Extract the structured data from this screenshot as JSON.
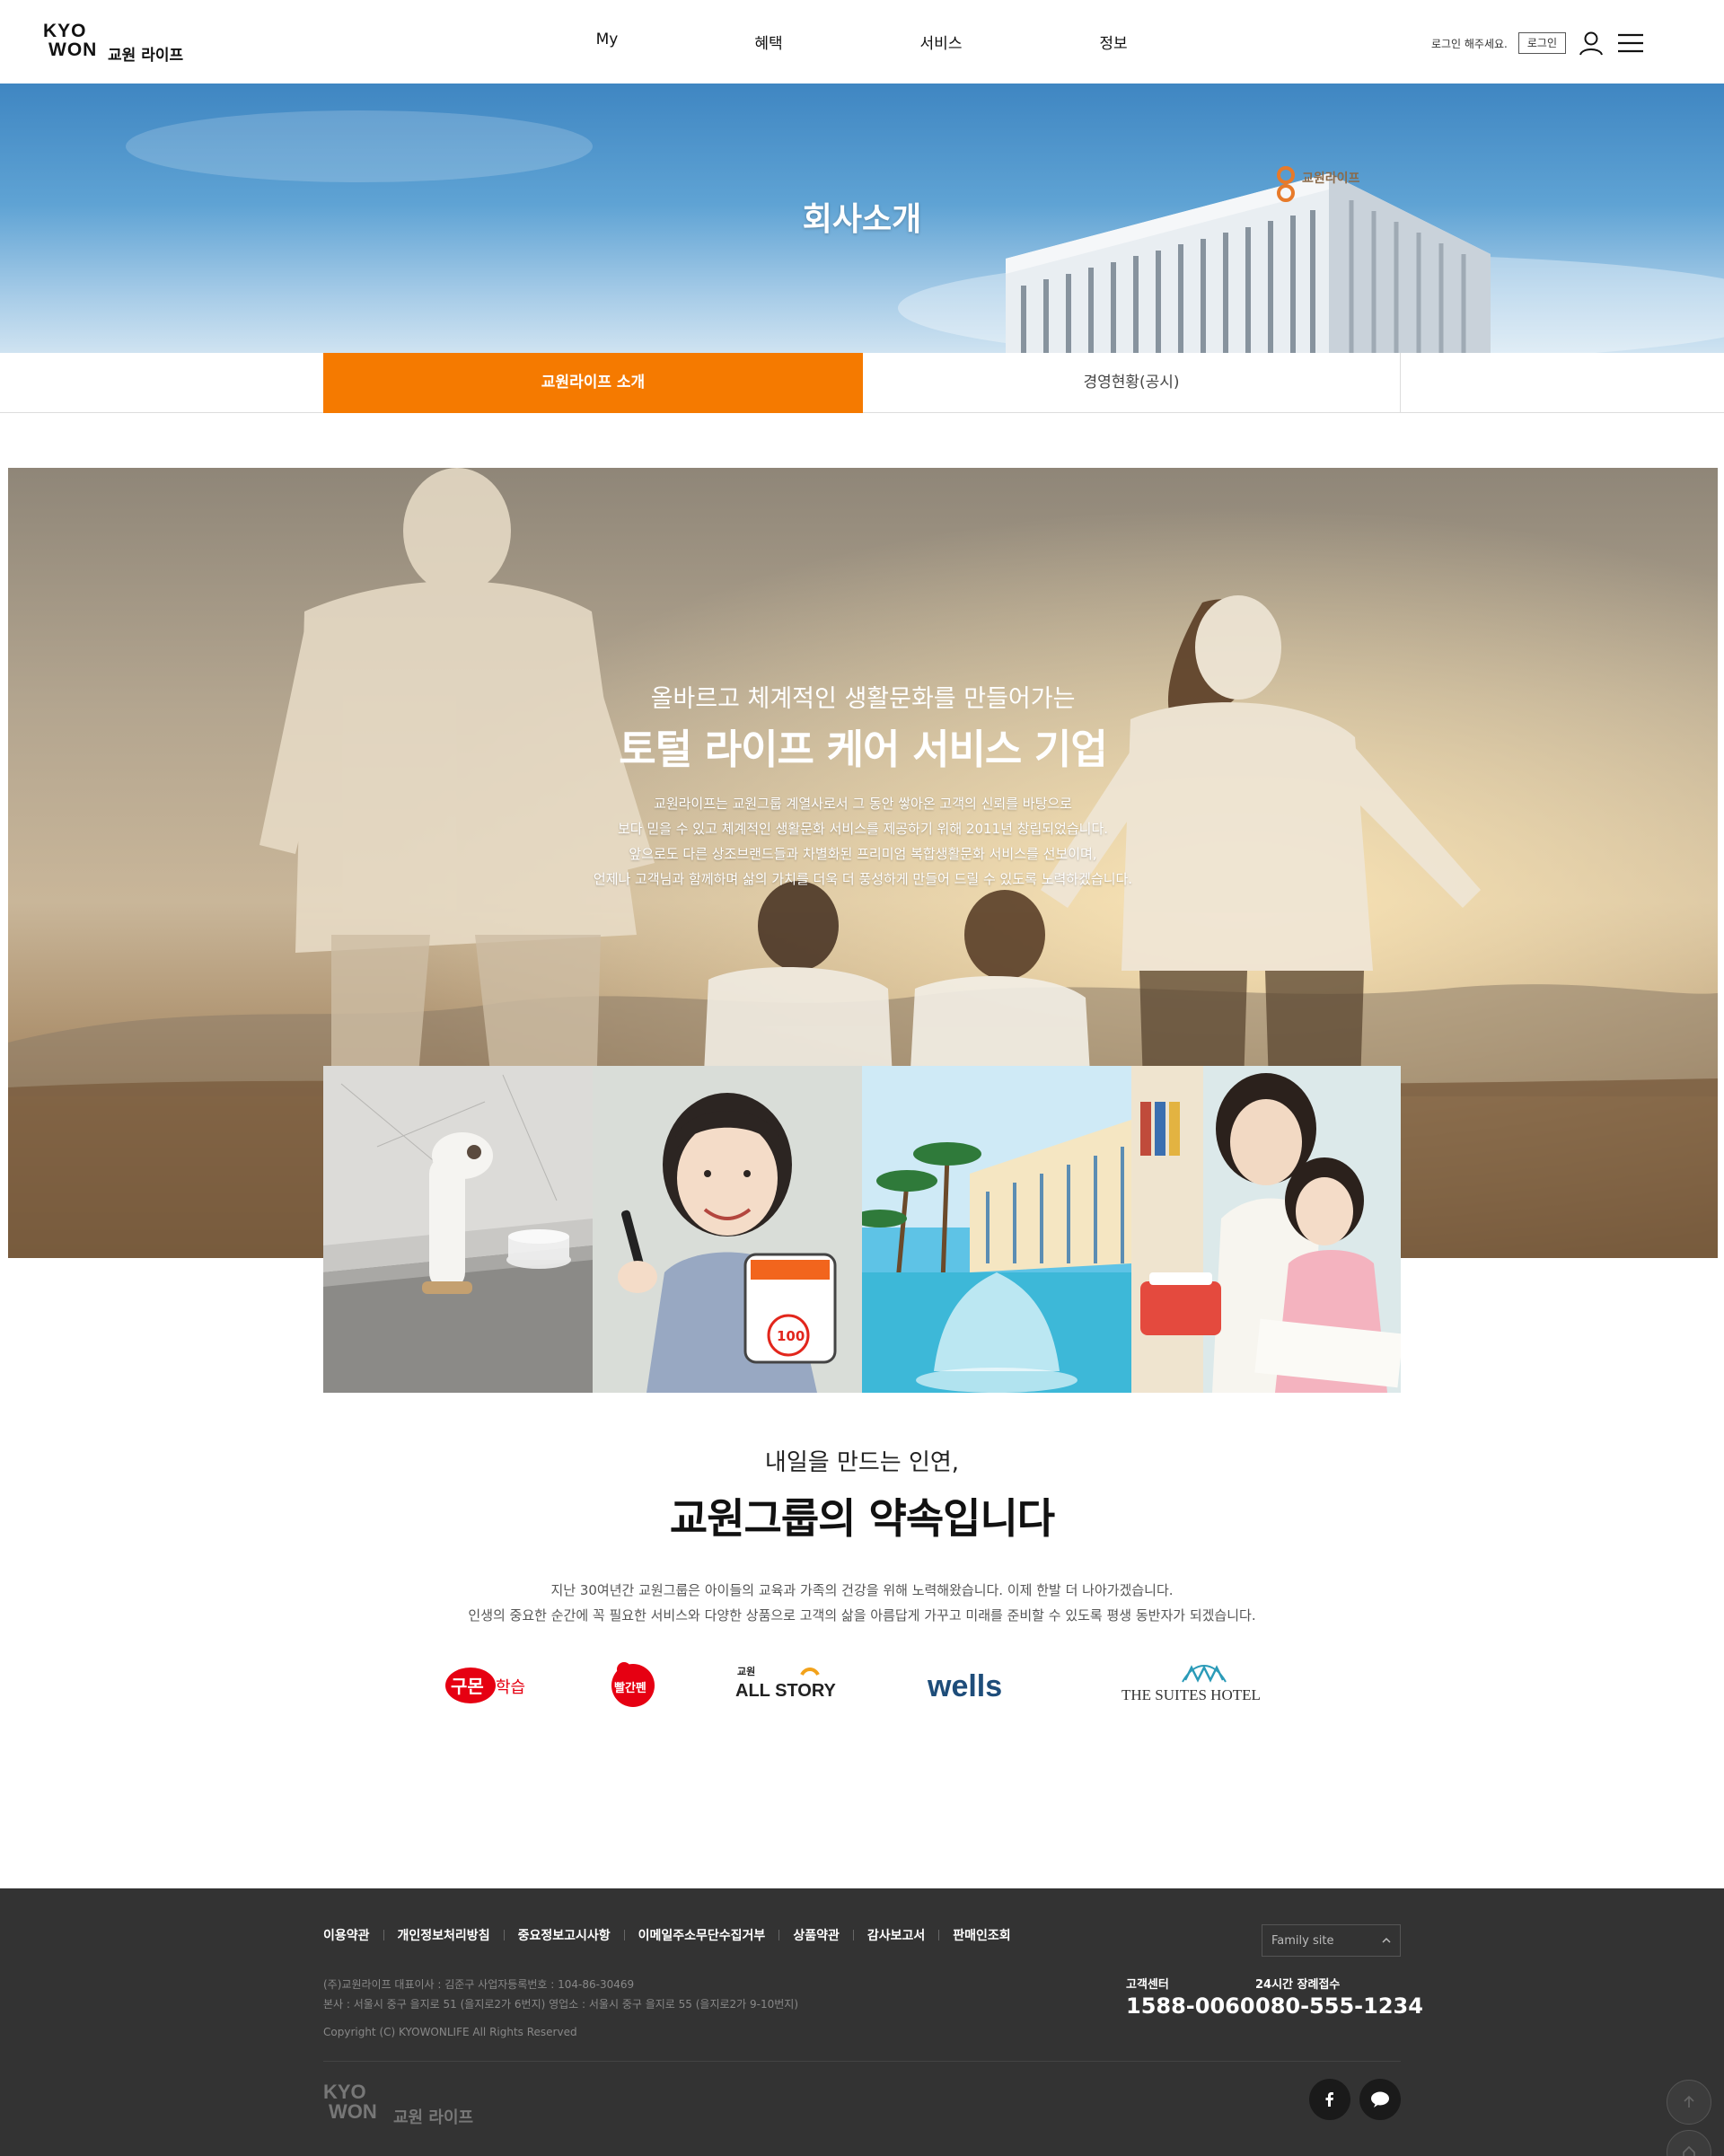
{
  "header": {
    "logo_mark_line1": "KYO",
    "logo_mark_line2": "WON",
    "logo_text": "교원 라이프",
    "nav": [
      "My",
      "혜택",
      "서비스",
      "정보"
    ],
    "login_message": "로그인 해주세요.",
    "login_button": "로그인",
    "icons": [
      "user-icon",
      "hamburger-menu-icon"
    ]
  },
  "hero": {
    "title": "회사소개",
    "building_sign": "교원라이프"
  },
  "tabs": [
    {
      "label": "교원라이프 소개",
      "active": true
    },
    {
      "label": "경영현황(공시)",
      "active": false
    }
  ],
  "intro": {
    "subtitle": "올바르고 체계적인 생활문화를 만들어가는",
    "title": "토털 라이프 케어 서비스 기업",
    "body": [
      "교원라이프는 교원그룹 계열사로서 그 동안 쌓아온 고객의 신뢰를 바탕으로",
      "보다 믿을 수 있고 체계적인 생활문화 서비스를 제공하기 위해 2011년 창립되었습니다.",
      "앞으로도 다른 상조브랜드들과 차별화된 프리미엄 복합생활문화 서비스를 선보이며,",
      "언제나 고객님과 함께하며 삶의 가치를 더욱 더 풍성하게 만들어 드릴 수 있도록 노력하겠습니다."
    ]
  },
  "photos": [
    "water-purifier-photo",
    "student-tablet-photo",
    "resort-pool-photo",
    "mother-daughter-study-photo"
  ],
  "photo_texts": {
    "score": "100"
  },
  "promise": {
    "subtitle": "내일을 만드는 인연,",
    "title": "교원그룹의 약속입니다",
    "body": [
      "지난 30여년간 교원그룹은 아이들의 교육과 가족의 건강을 위해 노력해왔습니다. 이제 한발 더 나아가겠습니다.",
      "인생의 중요한 순간에 꼭 필요한 서비스와 다양한 상품으로 고객의 삶을 아름답게 가꾸고 미래를 준비할 수 있도록 평생 동반자가 되겠습니다."
    ]
  },
  "brands": {
    "kumon_main": "구몬",
    "kumon_sub": "학습",
    "ppalgan": "빨간펜",
    "allstory_top": "교원",
    "allstory_main": "ALL STORY",
    "wells": "wells",
    "suites": "THE SUITES HOTEL"
  },
  "footer": {
    "links": [
      "이용약관",
      "개인정보처리방침",
      "중요정보고시사항",
      "이메일주소무단수집거부",
      "상품약관",
      "감사보고서",
      "판매인조회"
    ],
    "family_site": "Family site",
    "info_line1": "(주)교원라이프 대표이사 : 김준구 사업자등록번호 : 104-86-30469",
    "info_line2": "본사 : 서울시 중구 을지로 51 (을지로2가 6번지) 영업소 : 서울시 중구 을지로 55 (을지로2가 9-10번지)",
    "copyright": "Copyright (C) KYOWONLIFE All Rights Reserved",
    "cs_label": "고객센터",
    "cs_number": "1588-0060",
    "funeral_label": "24시간 장례접수",
    "funeral_number": "080-555-1234",
    "logo_mark_line1": "KYO",
    "logo_mark_line2": "WON",
    "logo_text": "교원 라이프",
    "social": [
      "facebook-icon",
      "talk-bubble-icon"
    ]
  },
  "colors": {
    "accent": "#f57a00",
    "logo_orange": "#f47920",
    "footer_bg": "#333333",
    "wells_blue": "#1e4d7a",
    "kumon_red": "#e60012"
  }
}
